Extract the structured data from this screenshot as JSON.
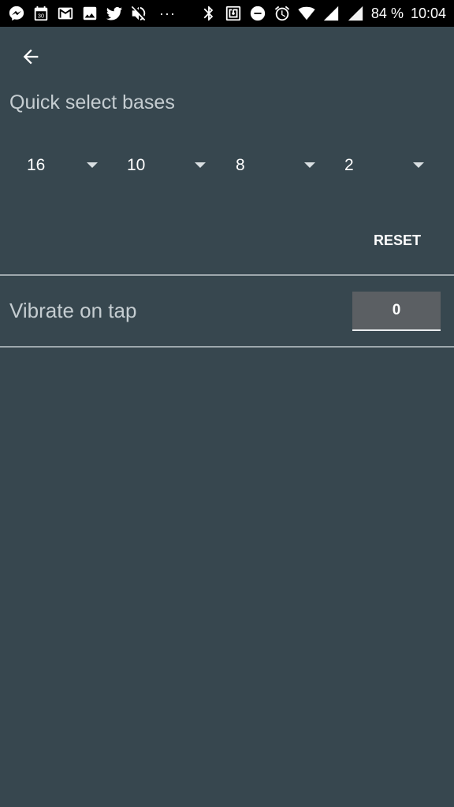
{
  "status_bar": {
    "icons": [
      "messenger-icon",
      "calendar-icon",
      "gmail-icon",
      "image-icon",
      "twitter-icon",
      "mute-icon"
    ],
    "calendar_day": "30",
    "more": "···",
    "right_icons": [
      "bluetooth-icon",
      "nfc-icon",
      "dnd-icon",
      "alarm-icon",
      "wifi-icon",
      "signal-icon",
      "signal-icon-2"
    ],
    "battery": "84 %",
    "time": "10:04"
  },
  "header": {
    "back_icon": "arrow-left-icon"
  },
  "quick_select": {
    "title": "Quick select bases",
    "bases": [
      "16",
      "10",
      "8",
      "2"
    ],
    "reset_label": "RESET"
  },
  "vibrate": {
    "label": "Vibrate on tap",
    "value": "0"
  },
  "colors": {
    "background": "#37474f",
    "text_secondary": "#c5cdd1",
    "input_bg": "#5b5f63",
    "divider": "#9ea8ad"
  }
}
